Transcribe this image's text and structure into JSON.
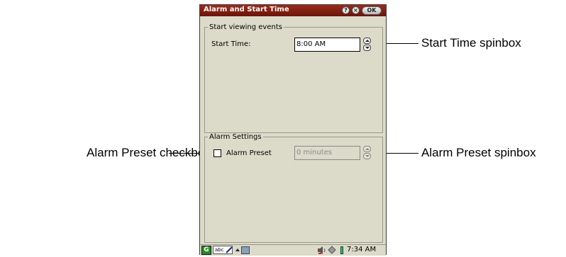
{
  "window": {
    "title": "Alarm and Start Time",
    "ok_label": "OK",
    "help_icon": "?",
    "close_icon": "×"
  },
  "start_group": {
    "legend": "Start viewing events",
    "start_time_label": "Start Time:",
    "start_time_value": "8:00 AM"
  },
  "alarm_group": {
    "legend": "Alarm Settings",
    "alarm_preset_label": "Alarm Preset",
    "alarm_preset_checked": false,
    "alarm_preset_value": "0 minutes"
  },
  "taskbar": {
    "start_icon_glyph": "G",
    "input_mode_label": "abc",
    "clock": "7:34 AM"
  },
  "callouts": {
    "start_time_spinbox": "Start Time spinbox",
    "alarm_preset_checkbox": "Alarm Preset checkbox",
    "alarm_preset_spinbox": "Alarm Preset spinbox"
  },
  "colors": {
    "titlebar": "#8a2214",
    "dialog_bg": "#dcdac8",
    "battery": "#39c82a",
    "start_icon": "#2e8a1e"
  }
}
